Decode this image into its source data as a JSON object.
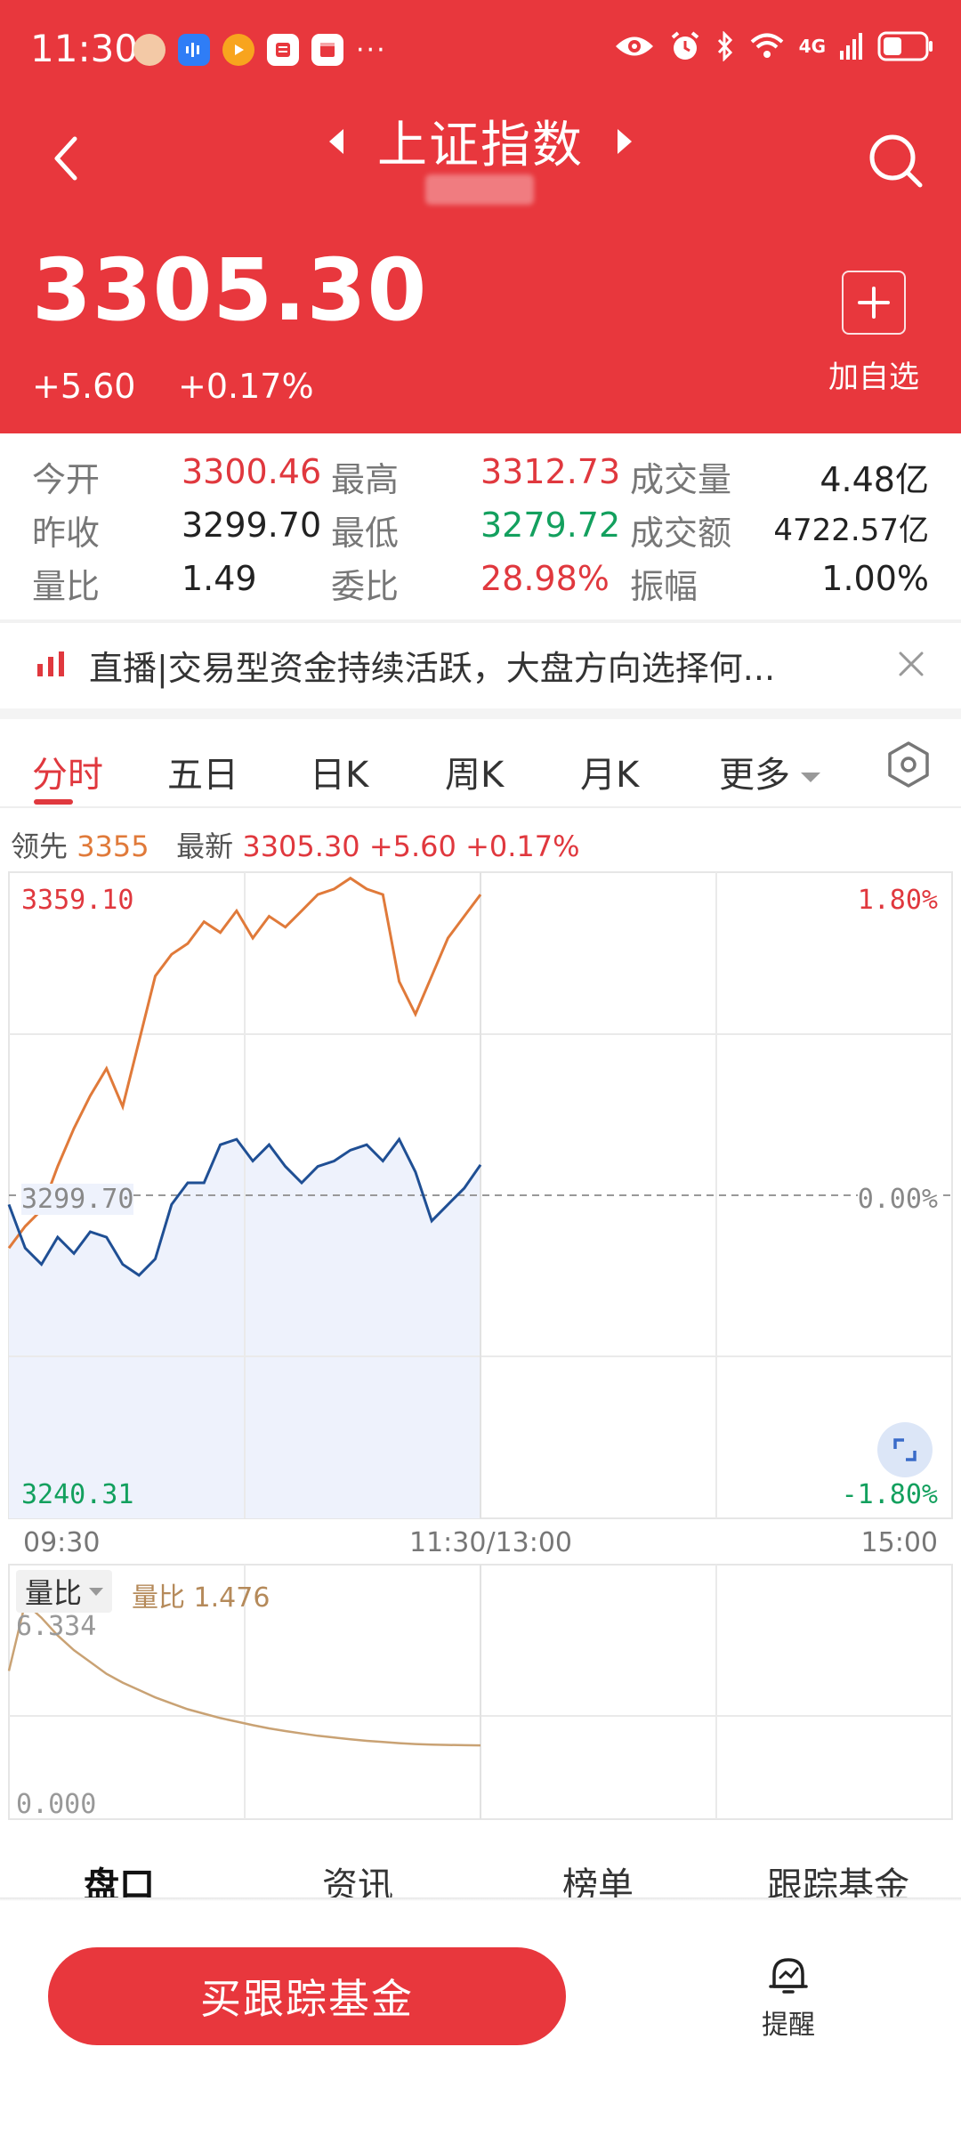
{
  "status_bar": {
    "time": "11:30",
    "network": "4G"
  },
  "header": {
    "title": "上证指数",
    "price": "3305.30",
    "change": "+5.60",
    "change_pct": "+0.17%",
    "add_watchlist_label": "加自选"
  },
  "quotes": [
    {
      "label": "今开",
      "value": "3300.46",
      "color": "red"
    },
    {
      "label": "最高",
      "value": "3312.73",
      "color": "red"
    },
    {
      "label": "成交量",
      "value": "4.48亿",
      "color": "black"
    },
    {
      "label": "昨收",
      "value": "3299.70",
      "color": "black"
    },
    {
      "label": "最低",
      "value": "3279.72",
      "color": "green"
    },
    {
      "label": "成交额",
      "value": "4722.57亿",
      "color": "black"
    },
    {
      "label": "量比",
      "value": "1.49",
      "color": "black"
    },
    {
      "label": "委比",
      "value": "28.98%",
      "color": "red"
    },
    {
      "label": "振幅",
      "value": "1.00%",
      "color": "black"
    }
  ],
  "news": {
    "text": "直播|交易型资金持续活跃，大盘方向选择何..."
  },
  "tabs": [
    "分时",
    "五日",
    "日K",
    "周K",
    "月K",
    "更多"
  ],
  "summary": {
    "lead_label": "领先",
    "lead_value": "3355",
    "latest_label": "最新",
    "latest_value": "3305.30",
    "change": "+5.60",
    "change_pct": "+0.17%"
  },
  "price_axis": {
    "top": "3359.10",
    "mid": "3299.70",
    "bottom": "3240.31",
    "top_pct": "1.80%",
    "mid_pct": "0.00%",
    "bottom_pct": "-1.80%"
  },
  "time_axis": {
    "start": "09:30",
    "mid": "11:30/13:00",
    "end": "15:00"
  },
  "volume": {
    "tag": "量比",
    "label": "量比 1.476",
    "top": "6.334",
    "bottom": "0.000"
  },
  "bottom_tabs": [
    "盘口",
    "资讯",
    "榜单",
    "跟踪基金"
  ],
  "buy_button": "买跟踪基金",
  "remind_label": "提醒",
  "colors": {
    "header_red": "#e8373d",
    "up_red": "#e0383e",
    "down_green": "#13a05e",
    "lead_line": "#e07a3a",
    "price_line": "#1f4f94",
    "price_fill": "#eef2fc",
    "volume_line": "#c9a274"
  },
  "chart_data": {
    "type": "line",
    "x": [
      "09:30",
      "11:30/13:00",
      "15:00"
    ],
    "ylim": [
      3240.31,
      3359.1
    ],
    "reference": 3299.7,
    "series": [
      {
        "name": "领先",
        "values": [
          3290,
          3294,
          3297,
          3305,
          3312,
          3318,
          3323,
          3316,
          3328,
          3340,
          3344,
          3346,
          3350,
          3348,
          3352,
          3347,
          3351,
          3349,
          3352,
          3355,
          3356,
          3358,
          3356,
          3355,
          3339,
          3333,
          3340,
          3347,
          3351,
          3355
        ]
      },
      {
        "name": "最新",
        "values": [
          3298,
          3290,
          3287,
          3292,
          3289,
          3293,
          3292,
          3287,
          3285,
          3288,
          3298,
          3302,
          3302,
          3309,
          3310,
          3306,
          3309,
          3305,
          3302,
          3305,
          3306,
          3308,
          3309,
          3306,
          3310,
          3304,
          3295,
          3298,
          3301,
          3305.3
        ]
      }
    ]
  },
  "volume_chart_data": {
    "type": "line",
    "ylim": [
      0,
      6.334
    ],
    "series": [
      {
        "name": "量比",
        "values": [
          4.0,
          6.3,
          5.8,
          5.2,
          4.7,
          4.3,
          3.9,
          3.6,
          3.35,
          3.1,
          2.9,
          2.7,
          2.55,
          2.4,
          2.28,
          2.16,
          2.05,
          1.96,
          1.88,
          1.8,
          1.74,
          1.68,
          1.63,
          1.59,
          1.55,
          1.52,
          1.5,
          1.49,
          1.48,
          1.476
        ]
      }
    ]
  }
}
